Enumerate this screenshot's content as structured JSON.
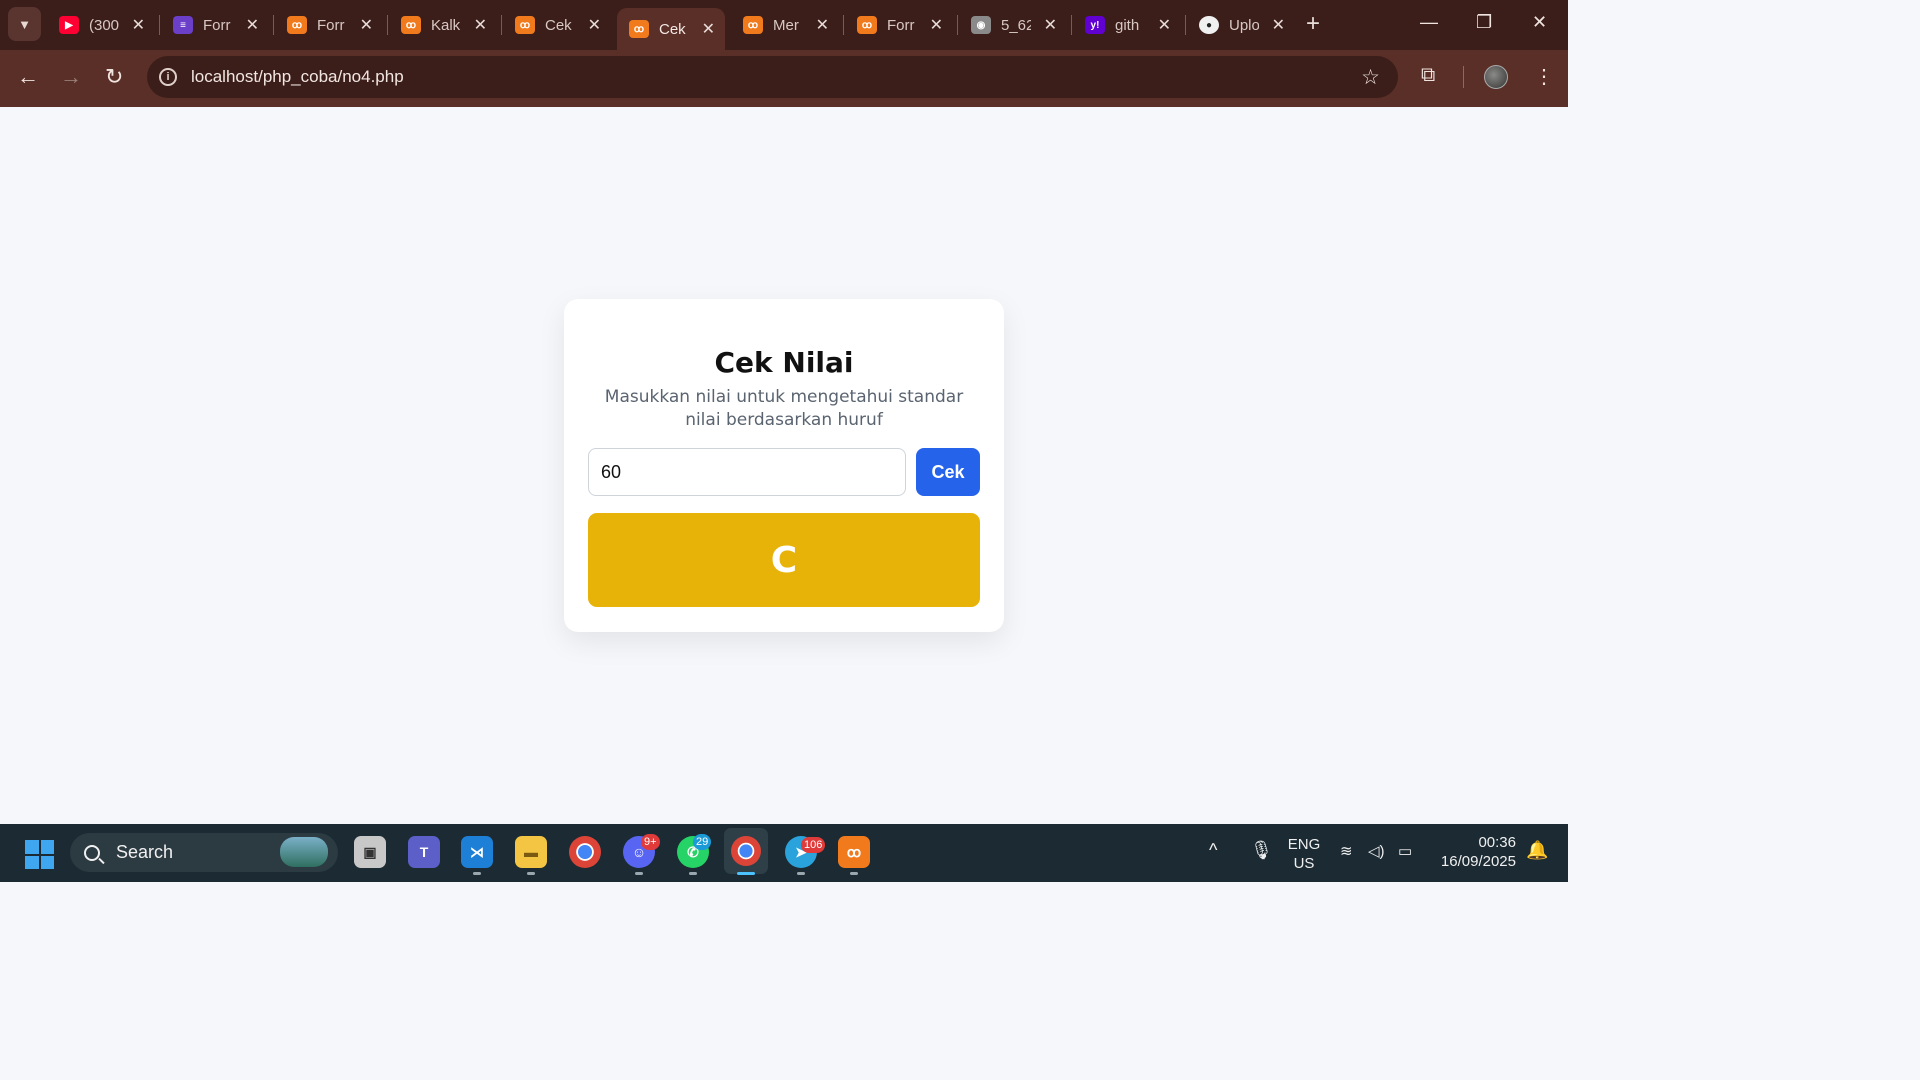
{
  "browser": {
    "tabs": [
      {
        "title": "(300",
        "icon": "youtube-icon",
        "color": "#ff0033",
        "glyph": "▶"
      },
      {
        "title": "Forr",
        "icon": "forms-icon",
        "color": "#6b3fc8",
        "glyph": "≡"
      },
      {
        "title": "Forr",
        "icon": "xampp-icon",
        "color": "#f07a1c",
        "glyph": "ꝏ"
      },
      {
        "title": "Kalk",
        "icon": "xampp-icon",
        "color": "#f07a1c",
        "glyph": "ꝏ"
      },
      {
        "title": "Cek",
        "icon": "xampp-icon",
        "color": "#f07a1c",
        "glyph": "ꝏ"
      },
      {
        "title": "Cek",
        "icon": "xampp-icon",
        "color": "#f07a1c",
        "glyph": "ꝏ",
        "active": true
      },
      {
        "title": "Mer",
        "icon": "xampp-icon",
        "color": "#f07a1c",
        "glyph": "ꝏ"
      },
      {
        "title": "Forr",
        "icon": "xampp-icon",
        "color": "#f07a1c",
        "glyph": "ꝏ"
      },
      {
        "title": "5_62",
        "icon": "globe-icon",
        "color": "#8a8a8a",
        "glyph": "◉"
      },
      {
        "title": "gith",
        "icon": "yahoo-icon",
        "color": "#6001d2",
        "glyph": "y!"
      },
      {
        "title": "Uplo",
        "icon": "github-icon",
        "color": "#f0f0f0",
        "glyph": "●"
      }
    ],
    "url": "localhost/php_coba/no4.php"
  },
  "page": {
    "title": "Cek Nilai",
    "description": "Masukkan nilai untuk mengetahui standar nilai berdasarkan huruf",
    "input_value": "60",
    "button_label": "Cek",
    "result_grade": "C",
    "result_color": "#e8b308",
    "button_color": "#2563eb"
  },
  "taskbar": {
    "search_label": "Search",
    "badges": {
      "discord": "9+",
      "whatsapp": "29",
      "telegram": "106"
    },
    "language": {
      "line1": "ENG",
      "line2": "US"
    },
    "time": "00:36",
    "date": "16/09/2025"
  }
}
